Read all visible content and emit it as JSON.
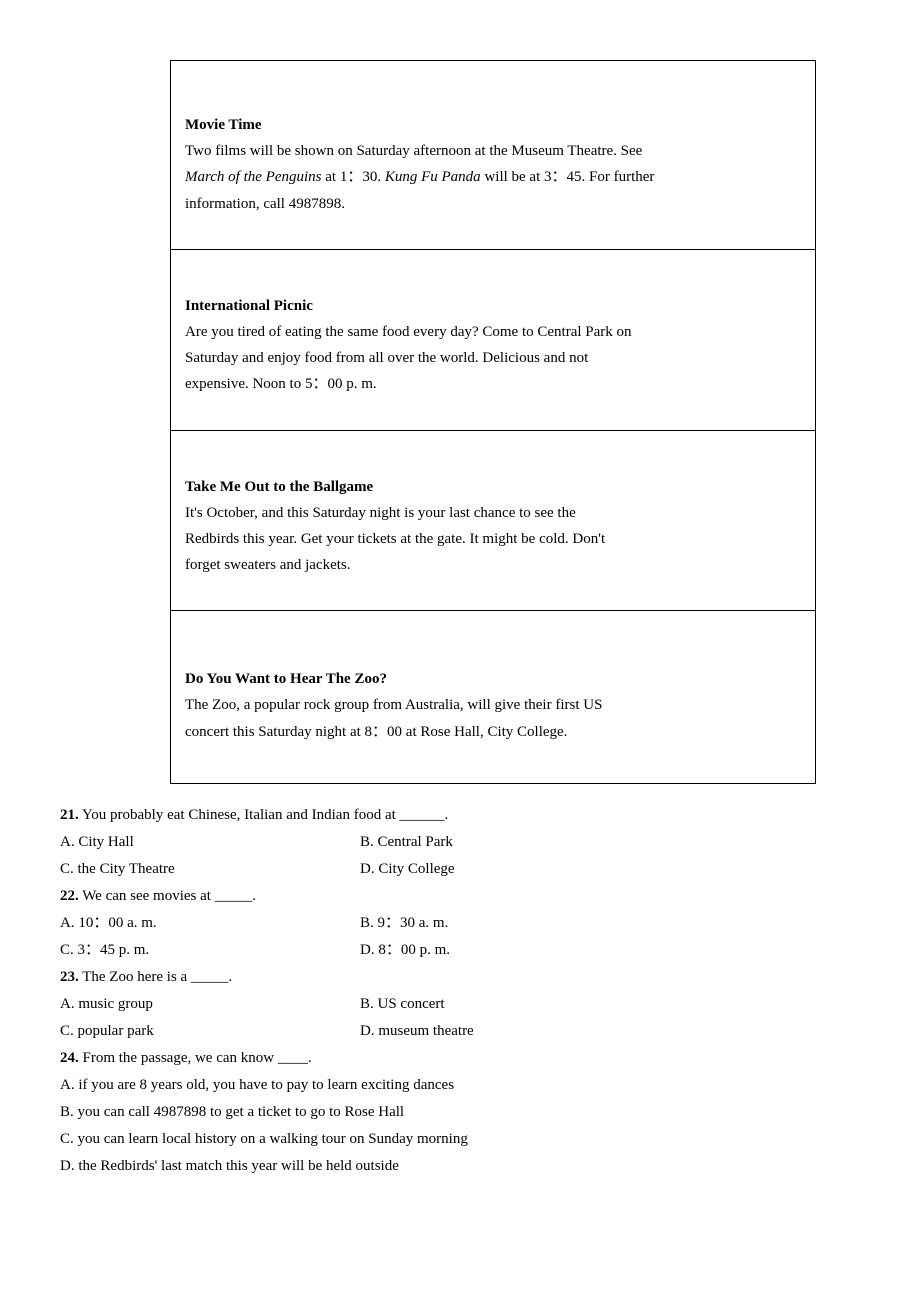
{
  "events": [
    {
      "title": "Movie Time",
      "lines": [
        "Two films will be shown on Saturday afternoon at the Museum Theatre. See",
        "<em>March of the Penguins</em> at 1：30. <em>Kung Fu Panda</em> will be at 3：45. For further",
        "information, call 4987898."
      ]
    },
    {
      "title": "International Picnic",
      "lines": [
        "Are you tired of eating the same food every day? Come to Central Park on",
        "Saturday and enjoy food from all over the world. Delicious and not",
        "expensive. Noon to 5：00 p. m."
      ]
    },
    {
      "title": "Take Me Out to the Ballgame",
      "lines": [
        "It's October, and this Saturday night is your last chance to see the",
        "Redbirds this year. Get your tickets at the gate. It might be cold. Don't",
        "forget sweaters and jackets."
      ]
    },
    {
      "title": "Do You Want to Hear The Zoo?",
      "lines": [
        "The Zoo, a popular rock group from Australia, will give their first US",
        "concert this Saturday night at 8：00 at Rose Hall, City College."
      ]
    }
  ],
  "questions": [
    {
      "num": "21.",
      "stem": " You probably eat Chinese, Italian and Indian food at ______.",
      "opts": [
        {
          "a": "A. City Hall",
          "b": "B. Central Park"
        },
        {
          "a": "C. the City Theatre",
          "b": "D. City College"
        }
      ]
    },
    {
      "num": "22.",
      "stem": " We can see movies at _____.",
      "opts": [
        {
          "a": "A. 10：00 a. m.",
          "b": "B. 9：30 a. m."
        },
        {
          "a": "C. 3：45 p. m.",
          "b": "D. 8：00 p. m."
        }
      ]
    },
    {
      "num": "23.",
      "stem": " The Zoo here is a _____.",
      "opts": [
        {
          "a": "A. music group",
          "b": "B. US concert"
        },
        {
          "a": "C. popular park",
          "b": "D. museum theatre"
        }
      ]
    },
    {
      "num": "24.",
      "stem": " From the passage, we can know ____.",
      "full": [
        "A. if you are 8 years old, you have to pay to learn exciting dances",
        "B. you can call 4987898 to get a ticket to go to Rose Hall",
        "C. you can learn local history on a walking tour on Sunday morning",
        "D. the Redbirds' last match this year will be held outside"
      ]
    }
  ]
}
